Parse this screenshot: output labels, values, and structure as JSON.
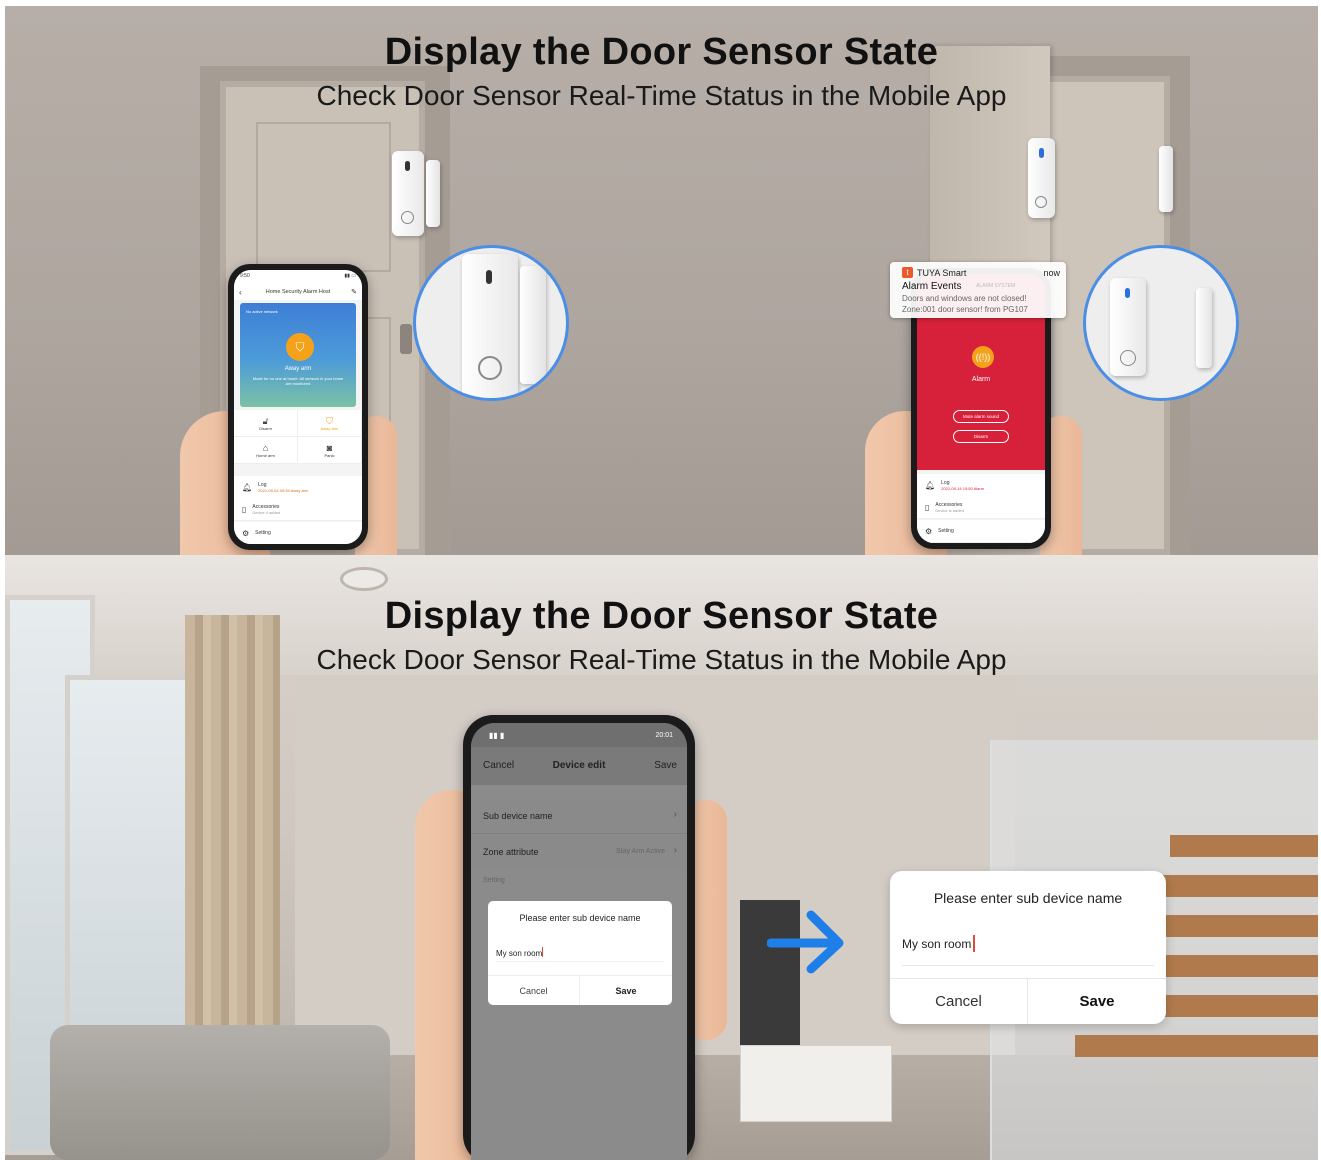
{
  "panel_top": {
    "title": "Display the Door Sensor State",
    "subtitle": "Check Door Sensor Real-Time Status in the Mobile App",
    "left_phone": {
      "status_time": "9:50",
      "header_title": "Home Security Alarm Host",
      "network_note": "No active network",
      "mode_label": "Away arm",
      "mode_desc": "Mode for no one at home: All sensors in your home are monitored",
      "buttons": [
        "Disarm",
        "Away arm",
        "Home arm",
        "Panic"
      ],
      "log_label": "Log",
      "log_value": "2021-09-04 09:35 Away arm",
      "accessories_label": "Accessories",
      "accessories_value": "Device 4 added",
      "setting_label": "Setting"
    },
    "notification": {
      "app": "TUYA Smart",
      "time": "now",
      "title": "Alarm Events",
      "tag": "ALARM SYSTEM",
      "line1": "Doors and windows are not closed!",
      "line2": "Zone:001 door sensor! from PG107"
    },
    "right_phone": {
      "alarm_label": "Alarm",
      "mute_button": "Mute alarm sound",
      "disarm_button": "Disarm",
      "log_label": "Log",
      "log_value": "2021-09-14 15:50 Alarm",
      "accessories_label": "Accessories",
      "accessories_value": "Device is added",
      "setting_label": "Setting"
    }
  },
  "panel_bottom": {
    "title": "Display the Door Sensor State",
    "subtitle": "Check Door Sensor Real-Time Status in the Mobile App",
    "phone": {
      "status_time": "20:01",
      "cancel": "Cancel",
      "header_title": "Device edit",
      "save": "Save",
      "row1_label": "Sub device name",
      "row2_label": "Zone attribute",
      "row2_value": "Stay Arm Active",
      "section_label": "Setting",
      "dialog_title": "Please enter sub device name",
      "dialog_value": "My son room",
      "dialog_cancel": "Cancel",
      "dialog_save": "Save"
    },
    "dialog": {
      "title": "Please enter sub device name",
      "value": "My son room",
      "cancel": "Cancel",
      "save": "Save"
    }
  },
  "colors": {
    "accent_blue": "#1e7fe8",
    "alarm_red": "#d7203a",
    "arm_orange": "#f5a21b",
    "map_blue": "#3e7fd6"
  }
}
